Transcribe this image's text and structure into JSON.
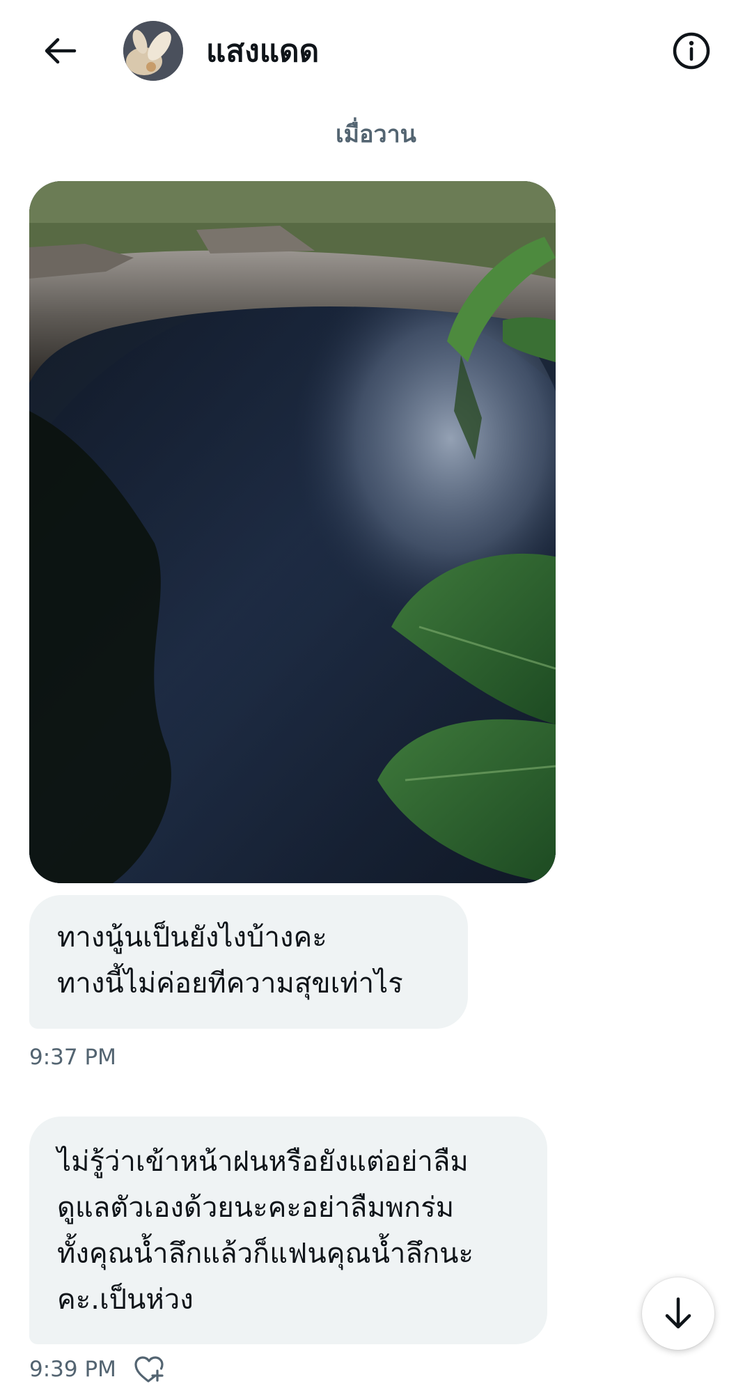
{
  "header": {
    "contact_name": "แสงแดด",
    "back_icon": "arrow-left-icon",
    "info_icon": "info-icon"
  },
  "conversation": {
    "day_label": "เมื่อวาน",
    "messages": [
      {
        "type": "image",
        "description_icon": "photo"
      },
      {
        "type": "text",
        "text": "ทางนู้นเป็นยังไงบ้างคะ\nทางนี้ไม่ค่อยทีความสุขเท่าไร",
        "time": "9:37 PM"
      },
      {
        "type": "text",
        "text": "ไม่รู้ว่าเข้าหน้าฝนหรือยังแต่อย่าลืม\nดูแลตัวเองด้วยนะคะอย่าลืมพกร่ม\nทั้งคุณน้ำลึกแล้วก็แฟนคุณน้ำลึกนะ\nคะ.เป็นห่วง",
        "time": "9:39 PM",
        "reaction_icon": "heart-plus-icon"
      }
    ]
  },
  "scroll_down_icon": "arrow-down-icon",
  "colors": {
    "bubble_bg": "#eff3f4",
    "muted_text": "#536471",
    "primary_text": "#0f1419"
  }
}
